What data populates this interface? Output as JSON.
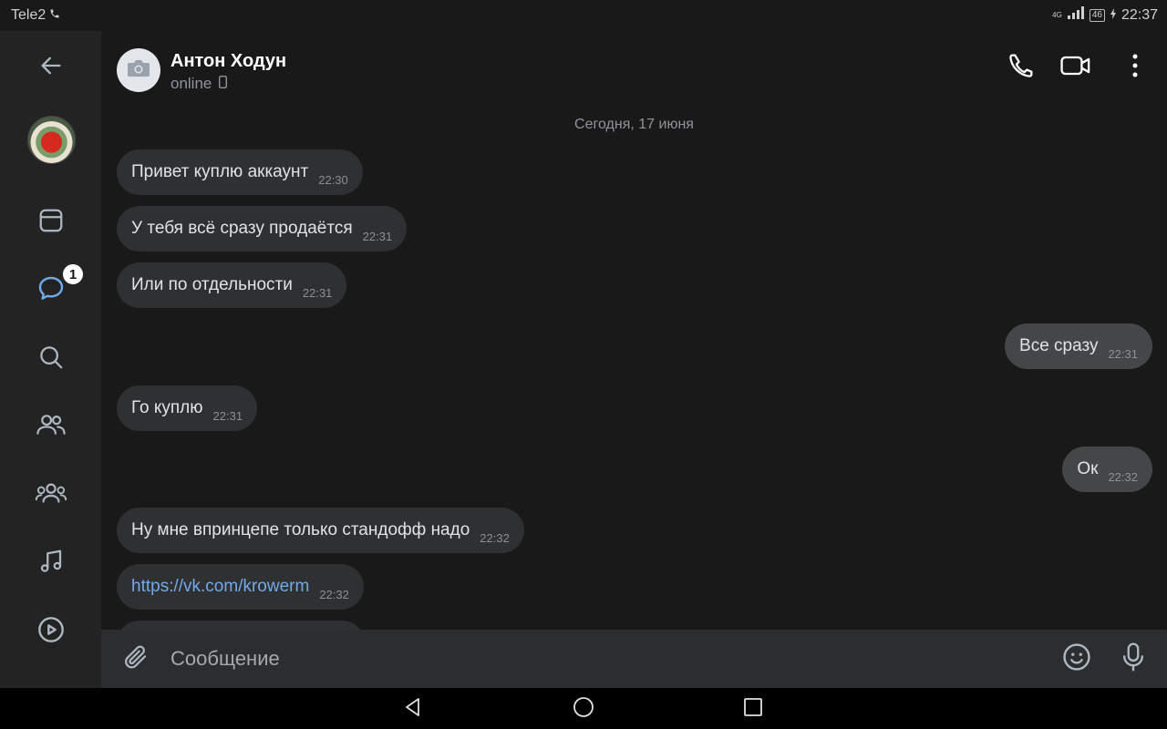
{
  "status_bar": {
    "carrier": "Tele2",
    "network": "4G",
    "battery": "46",
    "time": "22:37"
  },
  "sidebar": {
    "items": [
      {
        "name": "back",
        "icon": "arrow-left-icon"
      },
      {
        "name": "profile",
        "icon": "avatar"
      },
      {
        "name": "newsfeed",
        "icon": "newsfeed-icon"
      },
      {
        "name": "messages",
        "icon": "chat-bubble-icon",
        "active": true,
        "badge": "1"
      },
      {
        "name": "search",
        "icon": "search-icon"
      },
      {
        "name": "friends",
        "icon": "friends-icon"
      },
      {
        "name": "communities",
        "icon": "communities-icon"
      },
      {
        "name": "music",
        "icon": "music-note-icon"
      },
      {
        "name": "video",
        "icon": "play-circle-icon"
      }
    ]
  },
  "header": {
    "contact_name": "Антон Ходун",
    "contact_status": "online"
  },
  "chat": {
    "date_separator": "Сегодня, 17 июня",
    "messages": [
      {
        "direction": "in",
        "text": "Привет куплю аккаунт",
        "time": "22:30"
      },
      {
        "direction": "in",
        "text": "У тебя всё сразу продаётся",
        "time": "22:31"
      },
      {
        "direction": "in",
        "text": "Или по отдельности",
        "time": "22:31"
      },
      {
        "direction": "out",
        "text": "Все сразу",
        "time": "22:31"
      },
      {
        "direction": "in",
        "text": "Го куплю",
        "time": "22:31"
      },
      {
        "direction": "out",
        "text": "Ок",
        "time": "22:32"
      },
      {
        "direction": "in",
        "text": "Ну мне впринцепе  только стандофф надо",
        "time": "22:32"
      },
      {
        "direction": "in",
        "text": "https://vk.com/krowerm",
        "time": "22:32",
        "is_link": true
      }
    ]
  },
  "composer": {
    "placeholder": "Сообщение"
  },
  "colors": {
    "background": "#19191a",
    "sidebar": "#232324",
    "bubble_in": "#2f3032",
    "bubble_out": "#454647",
    "accent": "#71aaeb",
    "composer": "#2c2d2e"
  }
}
